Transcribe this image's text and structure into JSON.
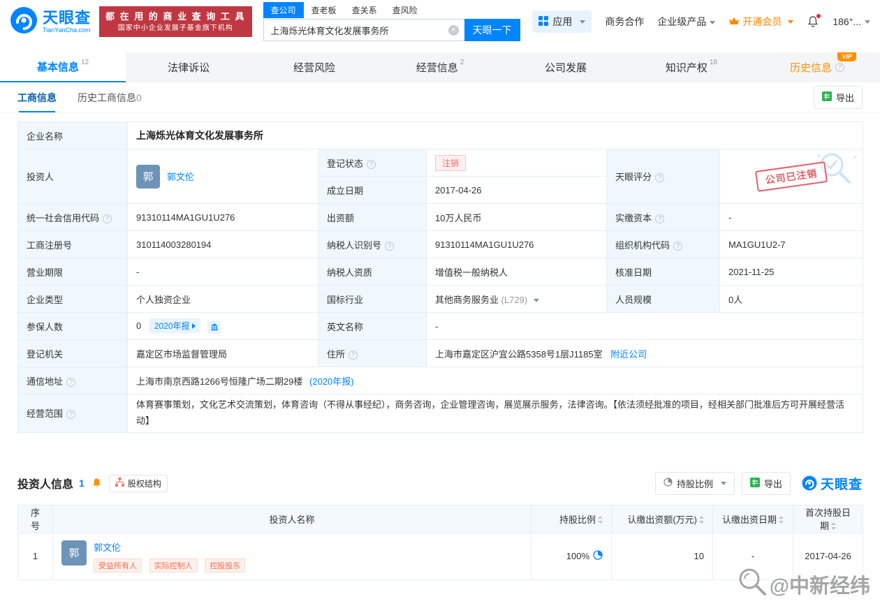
{
  "header": {
    "logo": {
      "name": "天眼查",
      "domain": "TianYanCha.com"
    },
    "slogan": {
      "line1": "都 在 用 的 商 业 查 询 工 具",
      "line2": "国家中小企业发展子基金旗下机构"
    },
    "search": {
      "tabs": [
        "查公司",
        "查老板",
        "查关系",
        "查风险"
      ],
      "value": "上海烁光体育文化发展事务所",
      "button": "天眼一下"
    },
    "nav": {
      "apps": "应用",
      "cooperation": "商务合作",
      "enterprise": "企业级产品",
      "member": "开通会员",
      "phone": "186°..."
    }
  },
  "tabs": [
    {
      "label": "基本信息",
      "count": "12"
    },
    {
      "label": "法律诉讼",
      "count": ""
    },
    {
      "label": "经营风险",
      "count": ""
    },
    {
      "label": "经营信息",
      "count": "2"
    },
    {
      "label": "公司发展",
      "count": ""
    },
    {
      "label": "知识产权",
      "count": "18"
    },
    {
      "label": "历史信息",
      "count": "",
      "vip": "VIP"
    }
  ],
  "subtabs": {
    "business": "工商信息",
    "history": "历史工商信息",
    "history_count": "0",
    "export": "导出"
  },
  "company": {
    "name_label": "企业名称",
    "name_value": "上海烁光体育文化发展事务所",
    "investor_label": "投资人",
    "investor_avatar": "郭",
    "investor_name": "郭文伦",
    "status_label": "登记状态",
    "status_value": "注销",
    "score_label": "天眼评分",
    "stamp_text": "公司已注销",
    "established_label": "成立日期",
    "established_value": "2017-04-26",
    "credit_code_label": "统一社会信用代码",
    "credit_code_value": "91310114MA1GU1U276",
    "capital_label": "出资额",
    "capital_value": "10万人民币",
    "paid_capital_label": "实缴资本",
    "paid_capital_value": "-",
    "reg_no_label": "工商注册号",
    "reg_no_value": "310114003280194",
    "taxpayer_id_label": "纳税人识别号",
    "taxpayer_id_value": "91310114MA1GU1U276",
    "org_code_label": "组织机构代码",
    "org_code_value": "MA1GU1U2-7",
    "term_label": "营业期限",
    "term_value": "-",
    "taxpayer_qual_label": "纳税人资质",
    "taxpayer_qual_value": "增值税一般纳税人",
    "approval_date_label": "核准日期",
    "approval_date_value": "2021-11-25",
    "type_label": "企业类型",
    "type_value": "个人独资企业",
    "industry_label": "国标行业",
    "industry_value": "其他商务服务业",
    "industry_code": "(L729)",
    "staff_label": "人员规模",
    "staff_value": "0人",
    "insured_label": "参保人数",
    "insured_value": "0",
    "insured_tag": "2020年报",
    "en_name_label": "英文名称",
    "en_name_value": "-",
    "authority_label": "登记机关",
    "authority_value": "嘉定区市场监督管理局",
    "address_label": "住所",
    "address_value": "上海市嘉定区沪宜公路5358号1层J1185室",
    "nearby_link": "附近公司",
    "mail_label": "通信地址",
    "mail_value": "上海市南京西路1266号恒隆广场二期29楼",
    "mail_report_link": "(2020年报)",
    "scope_label": "经营范围",
    "scope_value": "体育赛事策划，文化艺术交流策划，体育咨询（不得从事经纪），商务咨询，企业管理咨询，展览展示服务，法律咨询。【依法须经批准的项目，经相关部门批准后方可开展经营活动】"
  },
  "investors": {
    "title": "投资人信息",
    "count": "1",
    "equity": "股权结构",
    "ratio_filter": "持股比例",
    "export": "导出",
    "brand": "天眼查",
    "columns": [
      "序号",
      "投资人名称",
      "持股比例",
      "认缴出资额(万元)",
      "认缴出资日期",
      "首次持股日期"
    ],
    "row": {
      "index": "1",
      "avatar": "郭",
      "name": "郭文伦",
      "tags": [
        "受益所有人",
        "实际控制人",
        "控股股东"
      ],
      "ratio": "100%",
      "amount": "10",
      "subscribe_date": "-",
      "first_date": "2017-04-26"
    }
  },
  "watermark": "@中新经纬"
}
